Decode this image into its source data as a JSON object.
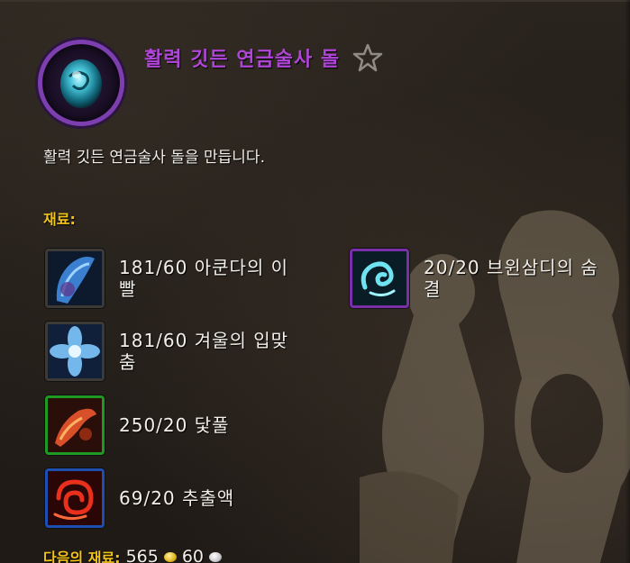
{
  "recipe": {
    "title": "활력 깃든 연금술사 돌",
    "description": "활력 깃든 연금술사 돌을 만듭니다.",
    "icon": "teal-stone-icon",
    "favorite_icon": "star-outline-icon"
  },
  "materials": {
    "label": "재료:",
    "items": [
      {
        "text": "181/60 아쿤다의 이빨",
        "icon": "akunda-tooth-icon",
        "quality_color": "#3d3a36"
      },
      {
        "text": "20/20 브윈삼디의 숨결",
        "icon": "bwonsamdi-breath-icon",
        "quality_color": "#7a2fa8"
      },
      {
        "text": "181/60 겨울의 입맞춤",
        "icon": "winters-kiss-icon",
        "quality_color": "#3d3a36"
      },
      {
        "text": "250/20 닻풀",
        "icon": "anchor-weed-icon",
        "quality_color": "#1e9a22"
      },
      {
        "text": "69/20 추출액",
        "icon": "expulsom-icon",
        "quality_color": "#1c4fb0"
      }
    ]
  },
  "footer": {
    "label": "다음의 재료:",
    "gold": "565",
    "silver": "60"
  },
  "colors": {
    "title": "#b046d8",
    "section_label": "#f3c316",
    "text": "#f2efe8",
    "background": "#221d18"
  }
}
